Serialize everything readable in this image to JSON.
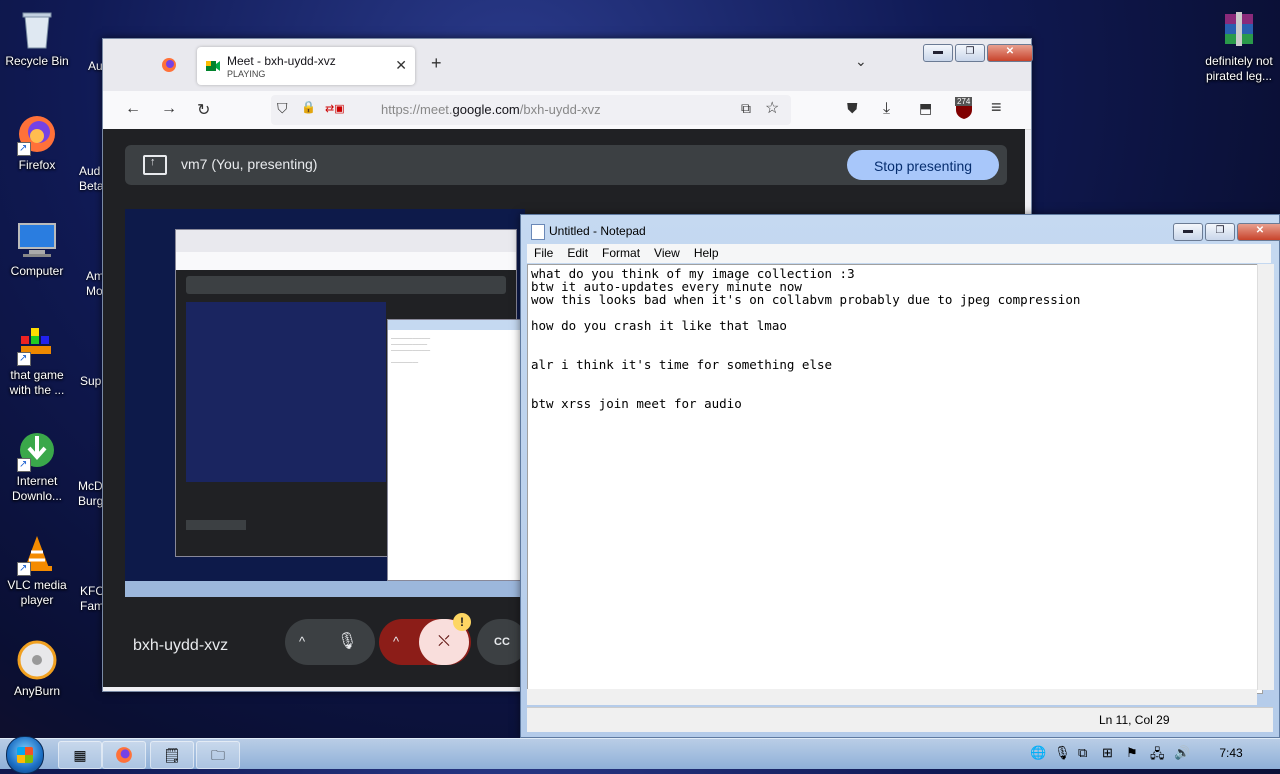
{
  "desktop": {
    "icons": [
      {
        "label": "Recycle Bin"
      },
      {
        "label": "Firefox"
      },
      {
        "label": "Computer"
      },
      {
        "label": "that game with the ..."
      },
      {
        "label": "Internet Downlo..."
      },
      {
        "label": "VLC media player"
      },
      {
        "label": "AnyBurn"
      },
      {
        "label": "definitely not pirated leg..."
      }
    ],
    "partial_icons": [
      {
        "label": "Au"
      },
      {
        "label": "Aud Beta"
      },
      {
        "label": "Am Mo"
      },
      {
        "label": "Sup"
      },
      {
        "label": "McD Burg"
      },
      {
        "label": "KFC Fam"
      }
    ]
  },
  "firefox": {
    "tab": {
      "title": "Meet - bxh-uydd-xvz",
      "subtitle": "PLAYING",
      "close": "✕"
    },
    "new_tab": "+",
    "tabs_list": "⌄",
    "url_prefix": "https://meet.",
    "url_domain": "google.com",
    "url_path": "/bxh-uydd-xvz",
    "window_buttons": {
      "min": "▬",
      "max": "❐",
      "close": "✕"
    },
    "toolbar": {
      "back": "←",
      "forward": "→",
      "reload": "↻",
      "shield": "⛉",
      "lock": "🔒",
      "star": "☆",
      "pocket": "⛊",
      "download": "⤓",
      "ext": "⬒",
      "menu": "≡",
      "badge": "274"
    }
  },
  "meet": {
    "presenting_text": "vm7 (You, presenting)",
    "stop_label": "Stop presenting",
    "meeting_code": "bxh-uydd-xvz",
    "controls": {
      "chevron": "^",
      "mic": "🎙",
      "cam": "⛌",
      "cc": "CC",
      "alert": "!"
    }
  },
  "notepad": {
    "title": "Untitled - Notepad",
    "menu": [
      "File",
      "Edit",
      "Format",
      "View",
      "Help"
    ],
    "text": "what do you think of my image collection :3\nbtw it auto-updates every minute now\nwow this looks bad when it's on collabvm probably due to jpeg compression\n\nhow do you crash it like that lmao\n\n\nalr i think it's time for something else\n\n\nbtw xrss join meet for audio",
    "status": "Ln 11, Col 29",
    "window_buttons": {
      "min": "▬",
      "max": "❐",
      "close": "✕"
    }
  },
  "taskbar": {
    "clock": "7:43"
  }
}
